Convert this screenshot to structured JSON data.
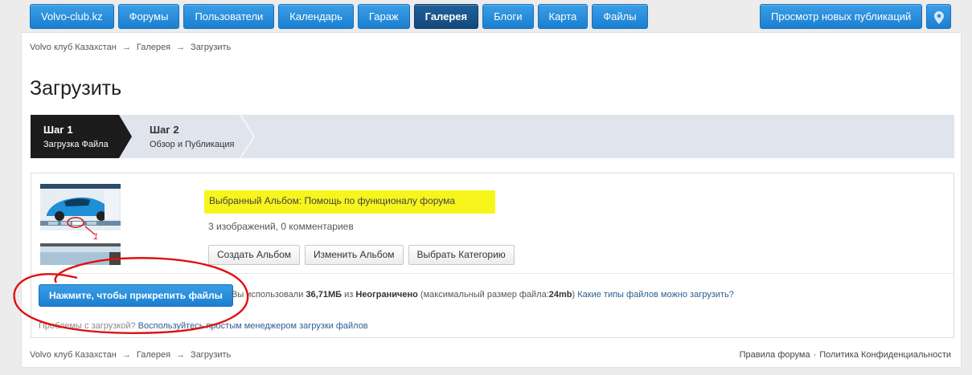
{
  "nav": {
    "items": [
      {
        "label": "Volvo-club.kz"
      },
      {
        "label": "Форумы"
      },
      {
        "label": "Пользователи"
      },
      {
        "label": "Календарь"
      },
      {
        "label": "Гараж"
      },
      {
        "label": "Галерея",
        "active": true
      },
      {
        "label": "Блоги"
      },
      {
        "label": "Карта"
      },
      {
        "label": "Файлы"
      }
    ],
    "new_posts_label": "Просмотр новых публикаций",
    "location_icon": "map-pin-icon"
  },
  "breadcrumb": {
    "items": [
      "Volvo клуб Казахстан",
      "Галерея",
      "Загрузить"
    ],
    "separator": "→"
  },
  "page": {
    "title": "Загрузить"
  },
  "steps": [
    {
      "title": "Шаг 1",
      "subtitle": "Загрузка Файла",
      "active": true
    },
    {
      "title": "Шаг 2",
      "subtitle": "Обзор и Публикация",
      "active": false
    }
  ],
  "album": {
    "title": "Выбранный Альбом: Помощь по функционалу форума",
    "meta": "3 изображений, 0 комментариев",
    "buttons": {
      "create": "Создать Альбом",
      "edit": "Изменить Альбом",
      "category": "Выбрать Категорию"
    }
  },
  "upload": {
    "button_label": "Нажмите, чтобы прикрепить файлы",
    "usage_prefix": "Вы использовали",
    "usage_used": "36,71МБ",
    "usage_of": "из",
    "usage_limit": "Неограничено",
    "max_size_prefix": "(максимальный размер файла:",
    "max_size_value": "24mb",
    "max_size_suffix": ")",
    "file_types_link": "Какие типы файлов можно загрузить?",
    "problem_text": "Проблемы с загрузкой?",
    "simple_uploader_link": "Воспользуйтесь простым менеджером загрузки файлов"
  },
  "footer": {
    "rules": "Правила форума",
    "privacy": "Политика Конфиденциальности",
    "dot": "·"
  },
  "annotation": {
    "number": "1"
  },
  "colors": {
    "accent_blue": "#1b7fd1",
    "active_blue": "#144a7c",
    "highlight_yellow": "#f7f51b",
    "annotation_red": "#e01010",
    "step_active": "#1c1c1c",
    "step_bar": "#e0e5ed"
  }
}
